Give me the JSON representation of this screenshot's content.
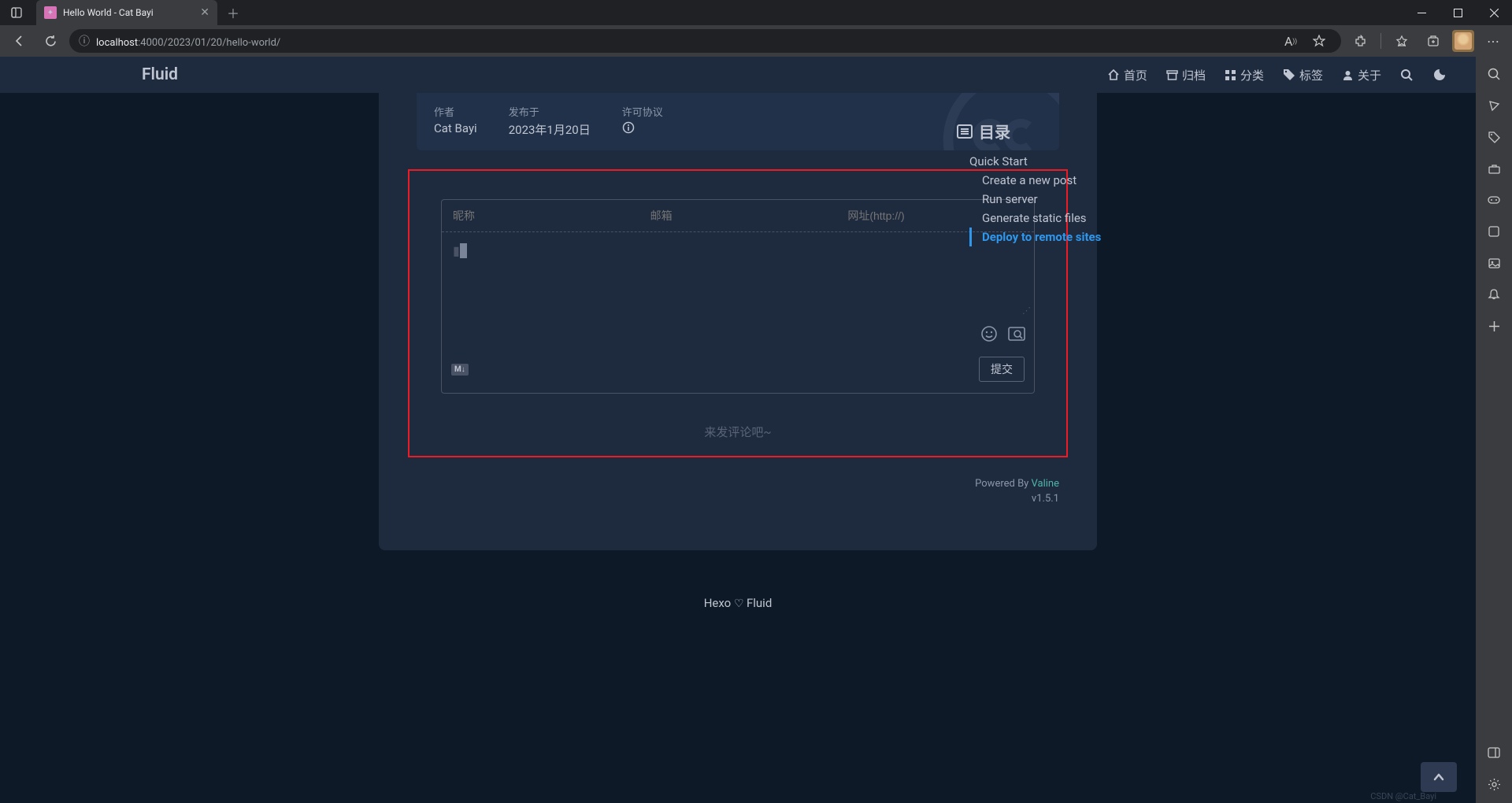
{
  "browser": {
    "tab_title": "Hello World - Cat Bayi",
    "url_host": "localhost",
    "url_path": ":4000/2023/01/20/hello-world/"
  },
  "nav": {
    "brand": "Fluid",
    "items": [
      {
        "icon": "home",
        "label": "首页"
      },
      {
        "icon": "archive",
        "label": "归档"
      },
      {
        "icon": "categories",
        "label": "分类"
      },
      {
        "icon": "tags",
        "label": "标签"
      },
      {
        "icon": "user",
        "label": "关于"
      }
    ]
  },
  "meta": {
    "author_label": "作者",
    "author_value": "Cat Bayi",
    "date_label": "发布于",
    "date_value": "2023年1月20日",
    "license_label": "许可协议"
  },
  "comments": {
    "nick_placeholder": "昵称",
    "mail_placeholder": "邮箱",
    "url_placeholder": "网址(http://)",
    "submit_label": "提交",
    "empty_text": "来发评论吧~",
    "powered_prefix": "Powered By ",
    "powered_name": "Valine",
    "version": "v1.5.1",
    "md_badge": "M↓"
  },
  "toc": {
    "title": "目录",
    "items": [
      {
        "label": "Quick Start",
        "level": 0,
        "active": false
      },
      {
        "label": "Create a new post",
        "level": 1,
        "active": false
      },
      {
        "label": "Run server",
        "level": 1,
        "active": false
      },
      {
        "label": "Generate static files",
        "level": 1,
        "active": false
      },
      {
        "label": "Deploy to remote sites",
        "level": 1,
        "active": true
      }
    ]
  },
  "footer": {
    "left": "Hexo",
    "right": "Fluid"
  },
  "watermark": "CSDN @Cat_Bayi"
}
